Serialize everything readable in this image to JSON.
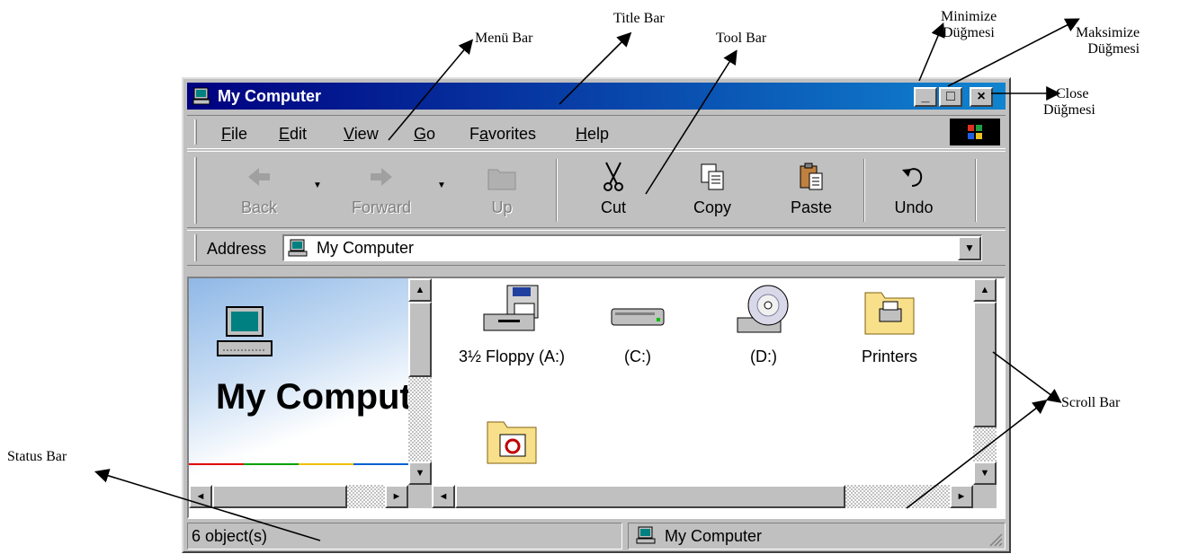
{
  "annotations": {
    "menu_bar": "Menü Bar",
    "title_bar": "Title   Bar",
    "tool_bar": "Tool Bar",
    "minimize_line1": "Minimize",
    "minimize_line2": "Düğmesi",
    "maximize_line1": "Maksimize",
    "maximize_line2": "Düğmesi",
    "close_line1": "Close",
    "close_line2": "Düğmesi",
    "scroll_bar": "Scroll Bar",
    "status_bar": "Status Bar"
  },
  "window": {
    "title": "My Computer",
    "buttons": {
      "minimize": "_",
      "maximize": "□",
      "close": "×"
    }
  },
  "menu": {
    "items": [
      "File",
      "Edit",
      "View",
      "Go",
      "Favorites",
      "Help"
    ]
  },
  "toolbar": {
    "back": "Back",
    "forward": "Forward",
    "up": "Up",
    "cut": "Cut",
    "copy": "Copy",
    "paste": "Paste",
    "undo": "Undo"
  },
  "address": {
    "label": "Address",
    "value": "My Computer"
  },
  "left_pane": {
    "title": "My Compute"
  },
  "items": [
    "3½ Floppy (A:)",
    "(C:)",
    "(D:)",
    "Printers"
  ],
  "status": {
    "objects": "6 object(s)",
    "location": "My Computer"
  },
  "colors": {
    "title_start": "#000080",
    "title_end": "#1084d0",
    "chrome": "#c0c0c0"
  }
}
